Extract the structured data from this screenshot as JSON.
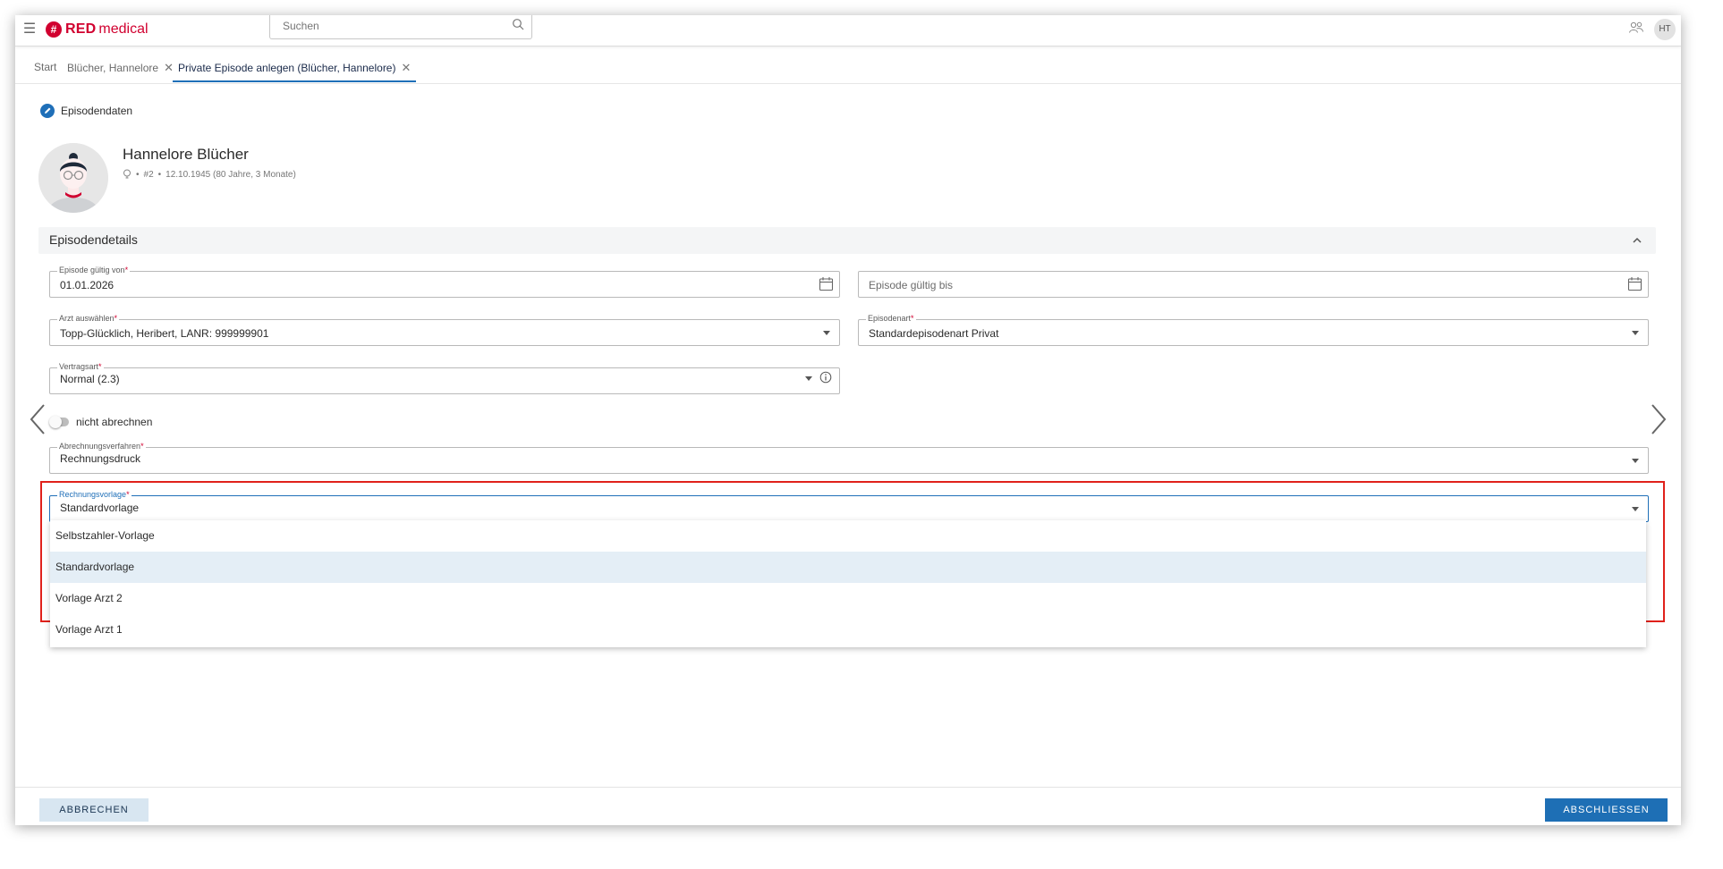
{
  "app": {
    "logo_red": "RED",
    "logo_medical": "medical",
    "user_initials": "HT"
  },
  "search": {
    "placeholder": "Suchen"
  },
  "tabs": [
    {
      "label": "Start"
    },
    {
      "label": "Blücher, Hannelore"
    },
    {
      "label": "Private Episode anlegen (Blücher, Hannelore)"
    }
  ],
  "section": {
    "title": "Episodendaten"
  },
  "patient": {
    "name": "Hannelore Blücher",
    "bullet": "•",
    "number": "#2",
    "birth": "12.10.1945 (80 Jahre, 3 Monate)"
  },
  "accordion": {
    "title": "Episodendetails"
  },
  "fields": {
    "valid_from": {
      "label": "Episode gültig von",
      "value": "01.01.2026"
    },
    "valid_to": {
      "placeholder": "Episode gültig bis"
    },
    "doctor": {
      "label": "Arzt auswählen",
      "value": "Topp-Glücklich, Heribert, LANR: 999999901"
    },
    "episode_type": {
      "label": "Episodenart",
      "value": "Standardepisodenart Privat"
    },
    "contract_type": {
      "label": "Vertragsart",
      "value": "Normal (2.3)"
    },
    "billing_method": {
      "label": "Abrechnungsverfahren",
      "value": "Rechnungsdruck"
    },
    "invoice_template": {
      "label": "Rechnungsvorlage",
      "value": "Standardvorlage"
    },
    "required_mark": "*"
  },
  "toggle": {
    "label": "nicht abrechnen"
  },
  "dropdown": {
    "options": [
      {
        "label": "Selbstzahler-Vorlage"
      },
      {
        "label": "Standardvorlage"
      },
      {
        "label": "Vorlage Arzt 2"
      },
      {
        "label": "Vorlage Arzt 1"
      }
    ],
    "selected_index": 1
  },
  "footer": {
    "cancel_label": "ABBRECHEN",
    "finish_label": "ABSCHLIESSEN"
  },
  "colors": {
    "brand": "#d1002f",
    "accent": "#1e6fb5",
    "highlight": "#e0211b"
  }
}
